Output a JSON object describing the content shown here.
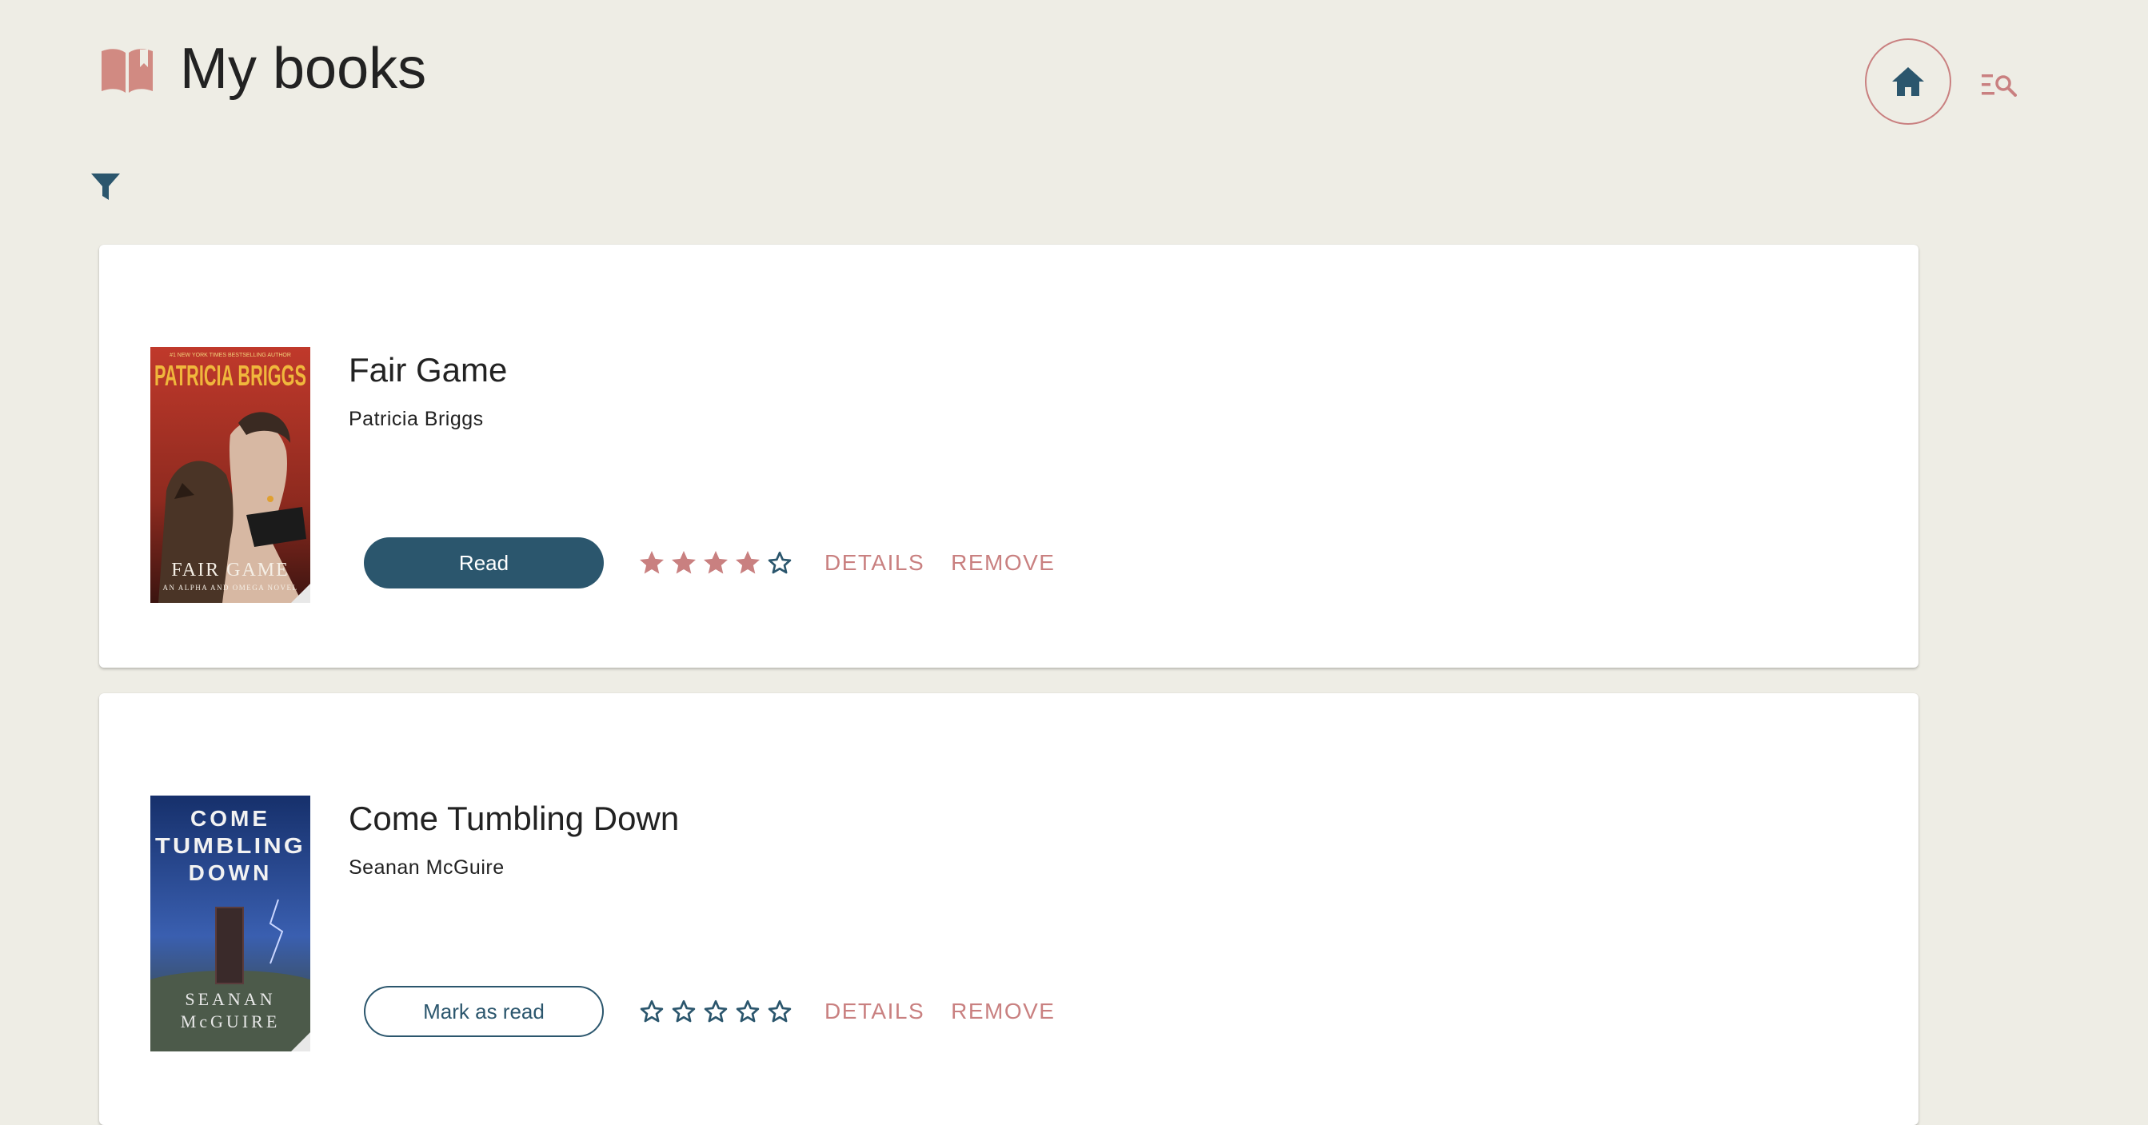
{
  "header": {
    "title": "My books"
  },
  "icons": {
    "logo": "open-book-icon",
    "home": "home-icon",
    "search_list": "list-search-icon",
    "filter": "filter-icon",
    "star_filled": "star-filled-icon",
    "star_empty": "star-outline-icon"
  },
  "colors": {
    "background": "#eeede5",
    "primary": "#2b566d",
    "accent": "#c98080",
    "card": "#ffffff",
    "text": "#222222"
  },
  "books": [
    {
      "title": "Fair Game",
      "author": "Patricia Briggs",
      "status_button": "Read",
      "status": "read",
      "rating": 4,
      "rating_max": 5,
      "details_label": "DETAILS",
      "remove_label": "REMOVE",
      "cover": {
        "top_text": "#1 NEW YORK TIMES BESTSELLING AUTHOR",
        "author_text": "PATRICIA BRIGGS",
        "title_text": "FAIR GAME",
        "series_text": "AN ALPHA AND OMEGA NOVEL"
      }
    },
    {
      "title": "Come Tumbling Down",
      "author": "Seanan McGuire",
      "status_button": "Mark as read",
      "status": "unread",
      "rating": 0,
      "rating_max": 5,
      "details_label": "DETAILS",
      "remove_label": "REMOVE",
      "cover": {
        "title_line_1": "COME",
        "title_line_2": "TUMBLING",
        "title_line_3": "DOWN",
        "author_line_1": "SEANAN",
        "author_line_2": "McGUIRE"
      }
    }
  ]
}
